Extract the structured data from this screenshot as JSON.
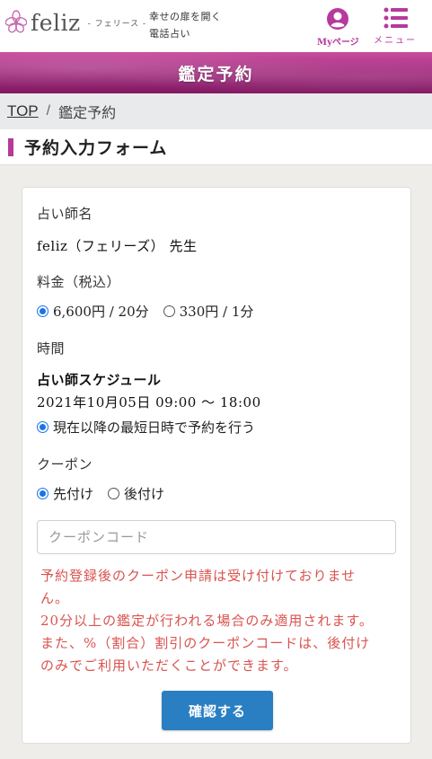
{
  "header": {
    "logo_text": "feliz",
    "logo_sub": "- フェリース -",
    "tagline_line1": "幸せの扉を開く",
    "tagline_line2": "電話占い",
    "mypage_label": "Myページ",
    "menu_label": "メニュー",
    "accent_color": "#b7399b"
  },
  "banner": {
    "title": "鑑定予約"
  },
  "breadcrumb": {
    "top": "TOP",
    "separator": "/",
    "current": "鑑定予約"
  },
  "section": {
    "title": "予約入力フォーム"
  },
  "form": {
    "fortune_teller_label": "占い師名",
    "fortune_teller_value": "feliz（フェリーズ） 先生",
    "fee_label": "料金（税込）",
    "fee_options": [
      {
        "label": "6,600円 / 20分",
        "checked": true
      },
      {
        "label": "330円 / 1分",
        "checked": false
      }
    ],
    "time_label": "時間",
    "schedule_title": "占い師スケジュール",
    "schedule_value": "2021年10月05日 09:00 ～ 18:00",
    "time_option": "現在以降の最短日時で予約を行う",
    "coupon_label": "クーポン",
    "coupon_options": [
      {
        "label": "先付け",
        "checked": true
      },
      {
        "label": "後付け",
        "checked": false
      }
    ],
    "coupon_placeholder": "クーポンコード",
    "coupon_value": "",
    "notice_lines": [
      "予約登録後のクーポン申請は受け付けておりませ",
      "ん。",
      "20分以上の鑑定が行われる場合のみ適用されます。",
      "また、%（割合）割引のクーポンコードは、後付け",
      "のみでご利用いただくことができます。"
    ],
    "confirm_label": "確認する"
  }
}
